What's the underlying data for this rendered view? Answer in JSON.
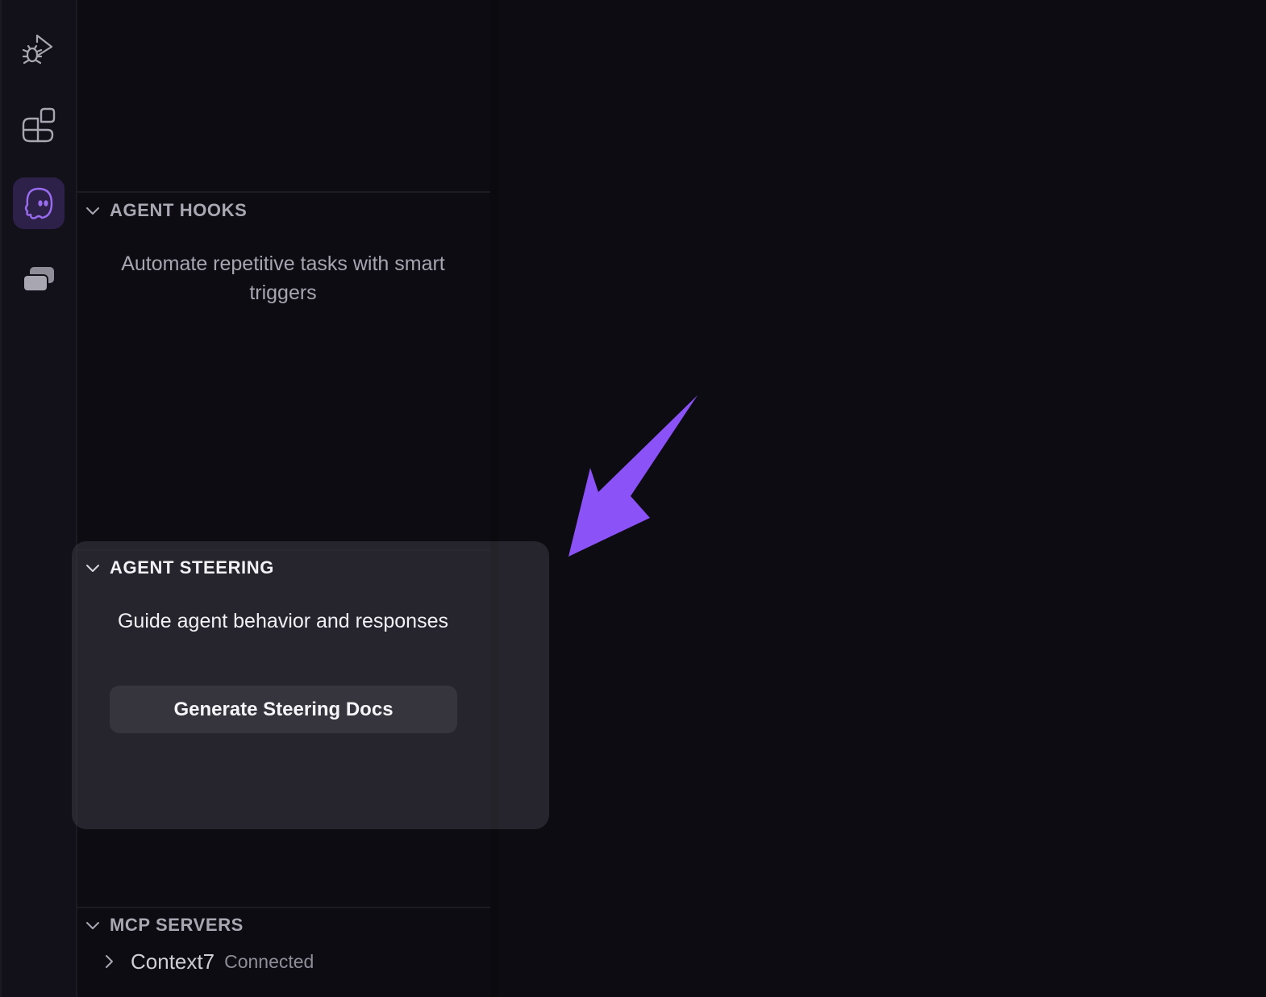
{
  "activity_bar": {
    "items": [
      {
        "icon": "run-debug-icon"
      },
      {
        "icon": "extensions-icon"
      },
      {
        "icon": "kiro-ghost-icon",
        "active": true
      },
      {
        "icon": "stacked-layers-icon"
      }
    ],
    "active_bg": "#2d2149"
  },
  "sections": {
    "agent_hooks": {
      "title": "AGENT HOOKS",
      "description": "Automate repetitive tasks with smart triggers"
    },
    "agent_steering": {
      "title": "AGENT STEERING",
      "description": "Guide agent behavior and responses",
      "button_label": "Generate Steering Docs"
    },
    "mcp_servers": {
      "title": "MCP SERVERS",
      "items": [
        {
          "name": "Context7",
          "status": "Connected"
        }
      ]
    }
  },
  "annotation": {
    "arrow_color": "#8b52f7"
  }
}
